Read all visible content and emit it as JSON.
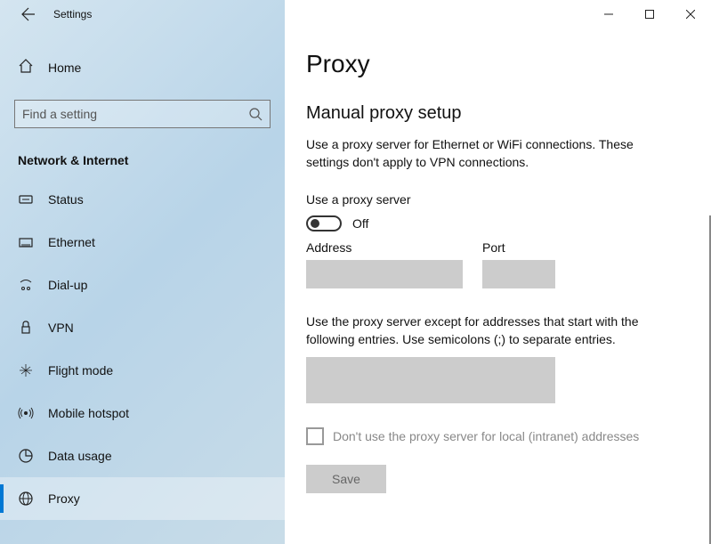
{
  "app": {
    "title": "Settings"
  },
  "home": {
    "label": "Home"
  },
  "search": {
    "placeholder": "Find a setting"
  },
  "section": {
    "header": "Network & Internet"
  },
  "nav": [
    {
      "key": "status",
      "label": "Status"
    },
    {
      "key": "ethernet",
      "label": "Ethernet"
    },
    {
      "key": "dialup",
      "label": "Dial-up"
    },
    {
      "key": "vpn",
      "label": "VPN"
    },
    {
      "key": "flightmode",
      "label": "Flight mode"
    },
    {
      "key": "hotspot",
      "label": "Mobile hotspot"
    },
    {
      "key": "datausage",
      "label": "Data usage"
    },
    {
      "key": "proxy",
      "label": "Proxy",
      "selected": true
    }
  ],
  "page": {
    "title": "Proxy",
    "subTitle": "Manual proxy setup",
    "desc": "Use a proxy server for Ethernet or WiFi connections. These settings don't apply to VPN connections.",
    "useProxyLabel": "Use a proxy server",
    "toggleState": "Off",
    "addressLabel": "Address",
    "portLabel": "Port",
    "addressValue": "",
    "portValue": "",
    "exceptionsDesc": "Use the proxy server except for addresses that start with the following entries. Use semicolons (;) to separate entries.",
    "exceptionsValue": "",
    "localCheckboxLabel": "Don't use the proxy server for local (intranet) addresses",
    "saveLabel": "Save"
  }
}
